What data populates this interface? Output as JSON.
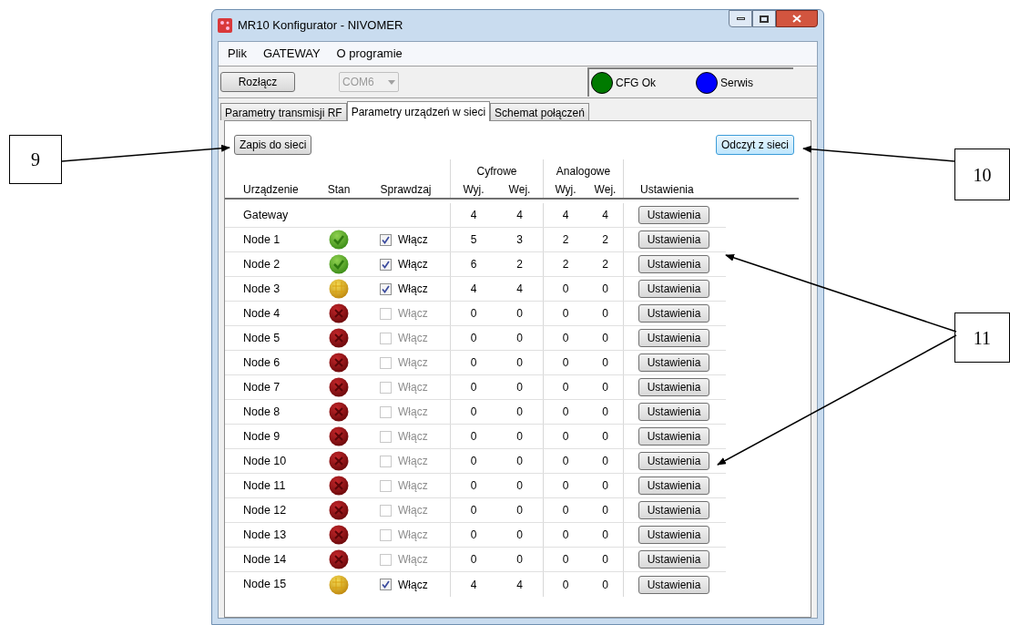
{
  "window": {
    "title": "MR10 Konfigurator - NIVOMER"
  },
  "menu": [
    "Plik",
    "GATEWAY",
    "O programie"
  ],
  "toolbar": {
    "connect_button": "Rozłącz",
    "port_select": {
      "value": "COM6",
      "disabled": true
    },
    "indicators": [
      {
        "label": "CFG Ok",
        "color": "#007a00"
      },
      {
        "label": "Serwis",
        "color": "#0000ff"
      }
    ]
  },
  "tabs": [
    {
      "label": "Parametry transmisji RF",
      "selected": false
    },
    {
      "label": "Parametry urządzeń w sieci",
      "selected": true
    },
    {
      "label": "Schemat połączeń",
      "selected": false
    }
  ],
  "write_button": "Zapis do sieci",
  "read_button": "Odczyt z sieci",
  "table": {
    "groups": [
      "Cyfrowe",
      "Analogowe"
    ],
    "columns": [
      "Urządzenie",
      "Stan",
      "Sprawdzaj",
      "Wyj.",
      "Wej.",
      "Wyj.",
      "Wej.",
      "Ustawienia"
    ],
    "rows": [
      {
        "name": "Gateway",
        "dig_out": "4",
        "dig_in": "4",
        "an_out": "4",
        "an_in": "4",
        "button": "Ustawienia"
      },
      {
        "name": "Node 1",
        "kind": "ok",
        "check": "Włącz",
        "checked": true,
        "dig_out": "5",
        "dig_in": "3",
        "an_out": "2",
        "an_in": "2",
        "button": "Ustawienia"
      },
      {
        "name": "Node 2",
        "kind": "ok",
        "check": "Włącz",
        "checked": true,
        "dig_out": "6",
        "dig_in": "2",
        "an_out": "2",
        "an_in": "2",
        "button": "Ustawienia"
      },
      {
        "name": "Node 3",
        "kind": "warning",
        "check": "Włącz",
        "checked": true,
        "dig_out": "4",
        "dig_in": "4",
        "an_out": "0",
        "an_in": "0",
        "button": "Ustawienia"
      },
      {
        "name": "Node 4",
        "kind": "error",
        "check": "Włącz",
        "checked": false,
        "dig_out": "0",
        "dig_in": "0",
        "an_out": "0",
        "an_in": "0",
        "button": "Ustawienia"
      },
      {
        "name": "Node 5",
        "kind": "error",
        "check": "Włącz",
        "checked": false,
        "dig_out": "0",
        "dig_in": "0",
        "an_out": "0",
        "an_in": "0",
        "button": "Ustawienia"
      },
      {
        "name": "Node 6",
        "kind": "error",
        "check": "Włącz",
        "checked": false,
        "dig_out": "0",
        "dig_in": "0",
        "an_out": "0",
        "an_in": "0",
        "button": "Ustawienia"
      },
      {
        "name": "Node 7",
        "kind": "error",
        "check": "Włącz",
        "checked": false,
        "dig_out": "0",
        "dig_in": "0",
        "an_out": "0",
        "an_in": "0",
        "button": "Ustawienia"
      },
      {
        "name": "Node 8",
        "kind": "error",
        "check": "Włącz",
        "checked": false,
        "dig_out": "0",
        "dig_in": "0",
        "an_out": "0",
        "an_in": "0",
        "button": "Ustawienia"
      },
      {
        "name": "Node 9",
        "kind": "error",
        "check": "Włącz",
        "checked": false,
        "dig_out": "0",
        "dig_in": "0",
        "an_out": "0",
        "an_in": "0",
        "button": "Ustawienia"
      },
      {
        "name": "Node 10",
        "kind": "error",
        "check": "Włącz",
        "checked": false,
        "dig_out": "0",
        "dig_in": "0",
        "an_out": "0",
        "an_in": "0",
        "button": "Ustawienia"
      },
      {
        "name": "Node 11",
        "kind": "error",
        "check": "Włącz",
        "checked": false,
        "dig_out": "0",
        "dig_in": "0",
        "an_out": "0",
        "an_in": "0",
        "button": "Ustawienia"
      },
      {
        "name": "Node 12",
        "kind": "error",
        "check": "Włącz",
        "checked": false,
        "dig_out": "0",
        "dig_in": "0",
        "an_out": "0",
        "an_in": "0",
        "button": "Ustawienia"
      },
      {
        "name": "Node 13",
        "kind": "error",
        "check": "Włącz",
        "checked": false,
        "dig_out": "0",
        "dig_in": "0",
        "an_out": "0",
        "an_in": "0",
        "button": "Ustawienia"
      },
      {
        "name": "Node 14",
        "kind": "error",
        "check": "Włącz",
        "checked": false,
        "dig_out": "0",
        "dig_in": "0",
        "an_out": "0",
        "an_in": "0",
        "button": "Ustawienia"
      },
      {
        "name": "Node 15",
        "kind": "warning",
        "check": "Włącz",
        "checked": true,
        "dig_out": "4",
        "dig_in": "4",
        "an_out": "0",
        "an_in": "0",
        "button": "Ustawienia"
      }
    ]
  },
  "callouts": [
    "9",
    "10",
    "11"
  ]
}
